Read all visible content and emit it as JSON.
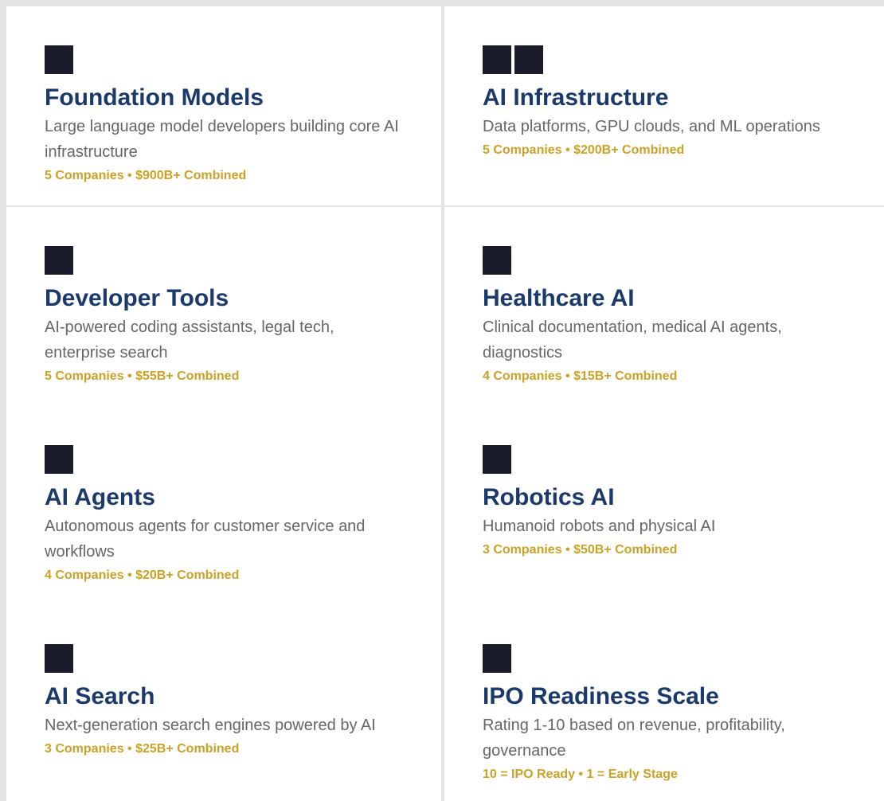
{
  "categories": [
    {
      "title": "Foundation Models",
      "description": "Large language model developers building core AI infrastructure",
      "stats": "5 Companies • $900B+ Combined",
      "icon_count": 1
    },
    {
      "title": "AI Infrastructure",
      "description": "Data platforms, GPU clouds, and ML operations",
      "stats": "5 Companies • $200B+ Combined",
      "icon_count": 2
    },
    {
      "title": "Developer Tools",
      "description": "AI-powered coding assistants, legal tech, enterprise search",
      "stats": "5 Companies • $55B+ Combined",
      "icon_count": 1
    },
    {
      "title": "Healthcare AI",
      "description": "Clinical documentation, medical AI agents, diagnostics",
      "stats": "4 Companies • $15B+ Combined",
      "icon_count": 1
    },
    {
      "title": "AI Agents",
      "description": "Autonomous agents for customer service and workflows",
      "stats": "4 Companies • $20B+ Combined",
      "icon_count": 1
    },
    {
      "title": "Robotics AI",
      "description": "Humanoid robots and physical AI",
      "stats": "3 Companies • $50B+ Combined",
      "icon_count": 1
    },
    {
      "title": "AI Search",
      "description": "Next-generation search engines powered by AI",
      "stats": "3 Companies • $25B+ Combined",
      "icon_count": 1
    },
    {
      "title": "IPO Readiness Scale",
      "description": "Rating 1-10 based on revenue, profitability, governance",
      "stats": "10 = IPO Ready • 1 = Early Stage",
      "icon_count": 1
    }
  ],
  "colors": {
    "title": "#1b3a6b",
    "stats": "#c9a227",
    "icon": "#1a1c2c",
    "description": "#666666",
    "background": "#e4e4e4",
    "card": "#ffffff"
  },
  "icons": {
    "category_icon": "square-icon"
  }
}
